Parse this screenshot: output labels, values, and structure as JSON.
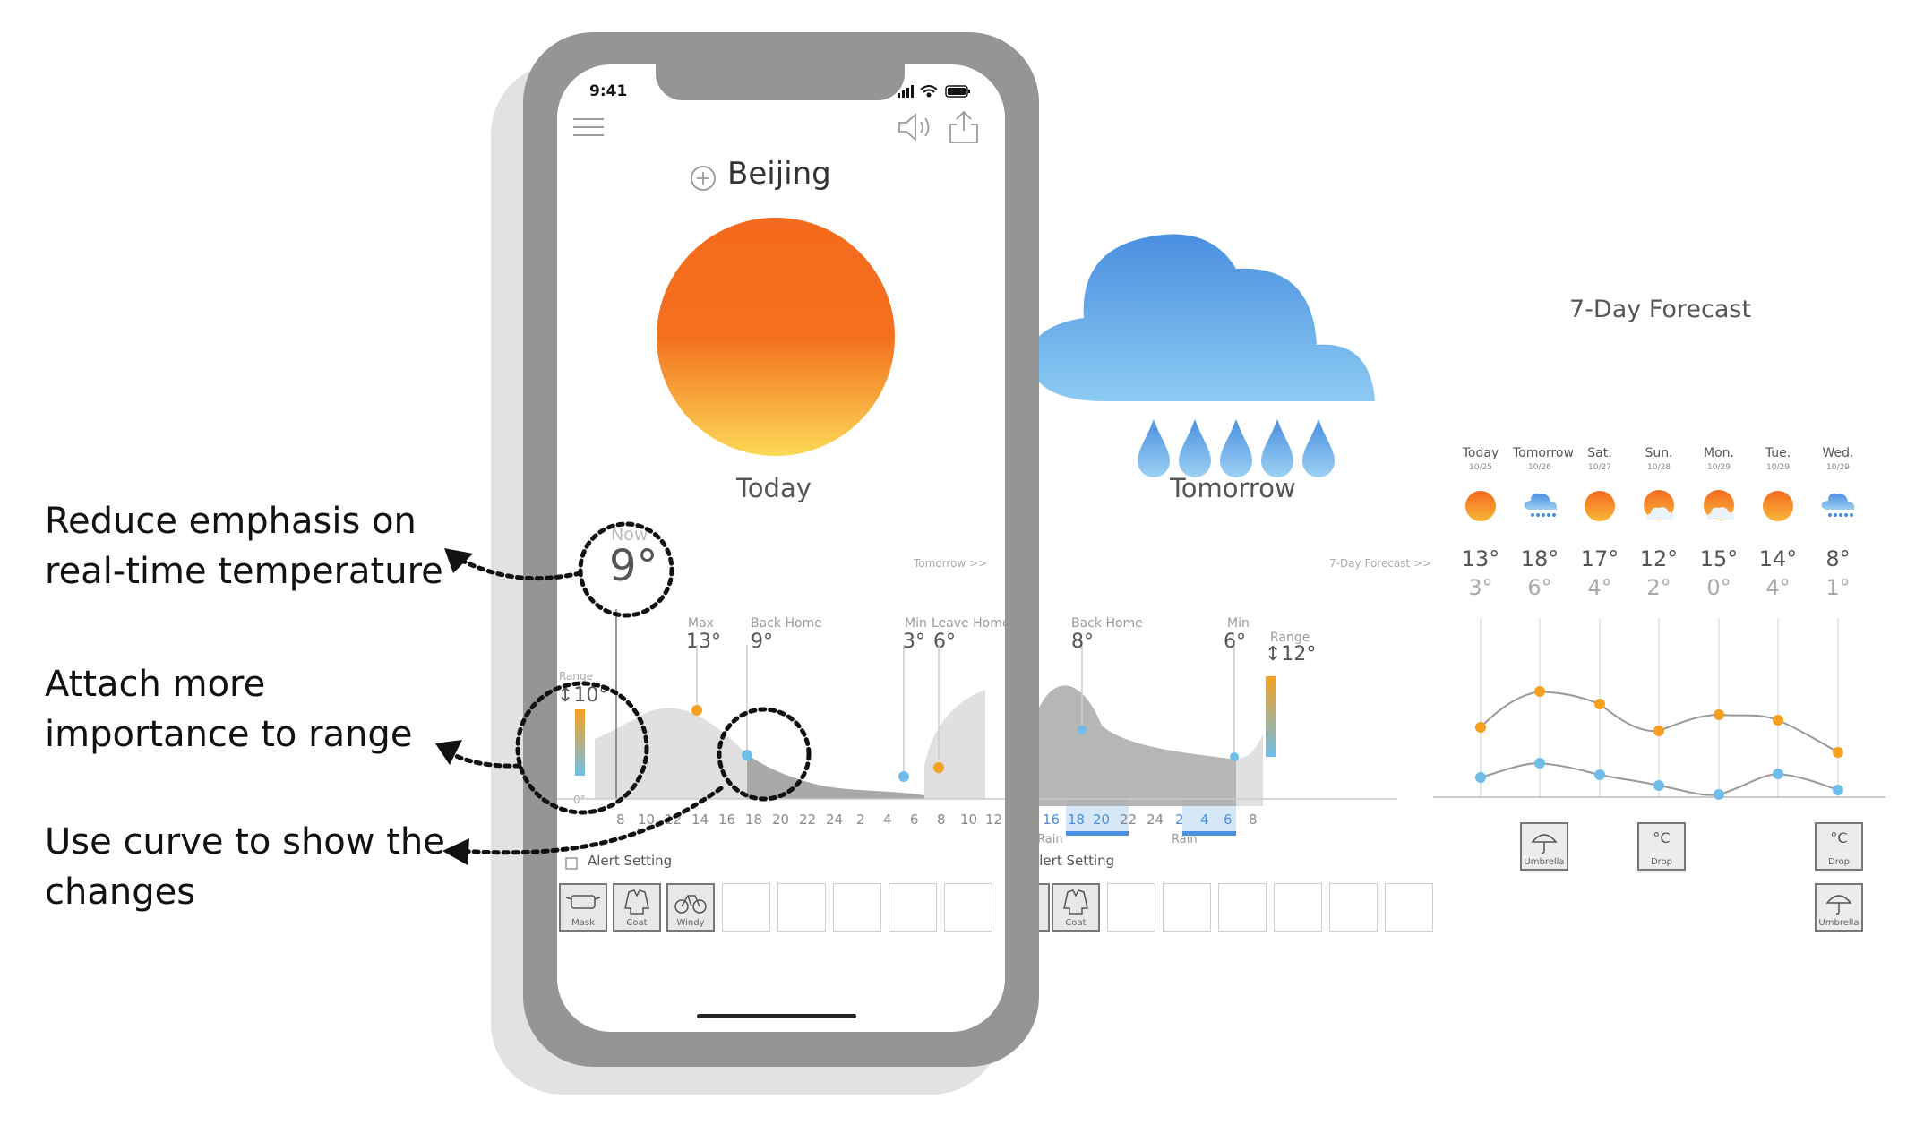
{
  "annotations": {
    "note1_line1": "Reduce emphasis on",
    "note1_line2": "real-time temperature",
    "note2_line1": "Attach more",
    "note2_line2": "importance to range",
    "note3_line1": "Use curve to show the",
    "note3_line2": "changes"
  },
  "status_bar": {
    "time": "9:41"
  },
  "header": {
    "city": "Beijing"
  },
  "today": {
    "label": "Today",
    "now_label": "Now",
    "now_temp": "9°",
    "tomorrow_link": "Tomorrow >>",
    "range_label": "Range",
    "range_value": "↕10°",
    "zero_label": "0°"
  },
  "today_markers": {
    "max_label": "Max",
    "max_value": "13°",
    "back_home_label": "Back Home",
    "back_home_value": "9°",
    "min_label": "Min",
    "min_value": "3°",
    "leave_home_label": "Leave Home",
    "leave_home_value": "6°"
  },
  "today_ticks": [
    "8",
    "10",
    "12",
    "14",
    "16",
    "18",
    "20",
    "22",
    "24",
    "2",
    "4",
    "6",
    "8",
    "10",
    "12"
  ],
  "alert_setting_label": "Alert Setting",
  "today_alerts": [
    {
      "label": "Mask",
      "icon": "mask-icon",
      "active": true
    },
    {
      "label": "Coat",
      "icon": "coat-icon",
      "active": true
    },
    {
      "label": "Windy",
      "icon": "bike-icon",
      "active": true
    }
  ],
  "tomorrow": {
    "label": "Tomorrow",
    "forecast_link": "7-Day Forecast >>",
    "back_home_label": "Back Home",
    "back_home_value": "8°",
    "min_label": "Min",
    "min_value": "6°",
    "range_label": "Range",
    "range_value": "↕12°",
    "rain_label": "Rain",
    "ticks": [
      "16",
      "18",
      "20",
      "22",
      "24",
      "2",
      "4",
      "6",
      "8"
    ],
    "alert_setting_label": "Alert Setting",
    "alert_partial_label": "lla",
    "alert_coat_label": "Coat"
  },
  "forecast": {
    "title": "7-Day Forecast",
    "days": [
      {
        "name": "Today",
        "date": "10/25",
        "max": "13°",
        "min": "3°",
        "icon": "sun-icon"
      },
      {
        "name": "Tomorrow",
        "date": "10/26",
        "max": "18°",
        "min": "6°",
        "icon": "rain-cloud-icon"
      },
      {
        "name": "Sat.",
        "date": "10/27",
        "max": "17°",
        "min": "4°",
        "icon": "sun-icon"
      },
      {
        "name": "Sun.",
        "date": "10/28",
        "max": "12°",
        "min": "2°",
        "icon": "partly-cloudy-icon"
      },
      {
        "name": "Mon.",
        "date": "10/29",
        "max": "15°",
        "min": "0°",
        "icon": "partly-cloudy-icon"
      },
      {
        "name": "Tue.",
        "date": "10/29",
        "max": "14°",
        "min": "4°",
        "icon": "sun-icon"
      },
      {
        "name": "Wed.",
        "date": "10/29",
        "max": "8°",
        "min": "1°",
        "icon": "rain-cloud-icon"
      }
    ],
    "alerts": [
      {
        "label": "Umbrella",
        "icon": "umbrella-icon"
      },
      {
        "label": "Drop",
        "icon": "temp-drop-icon",
        "glyph": "°C"
      },
      {
        "label": "Drop",
        "icon": "temp-drop-icon",
        "glyph": "°C"
      },
      {
        "label": "Umbrella",
        "icon": "umbrella-icon"
      }
    ]
  },
  "colors": {
    "accent_orange": "#f5a020",
    "accent_blue": "#6fbde8",
    "sun_top": "#f46a1e",
    "sun_bottom": "#fbd957",
    "cloud_top": "#4a8fe0",
    "cloud_bottom": "#8ccaf2",
    "phone_frame": "#959595"
  }
}
